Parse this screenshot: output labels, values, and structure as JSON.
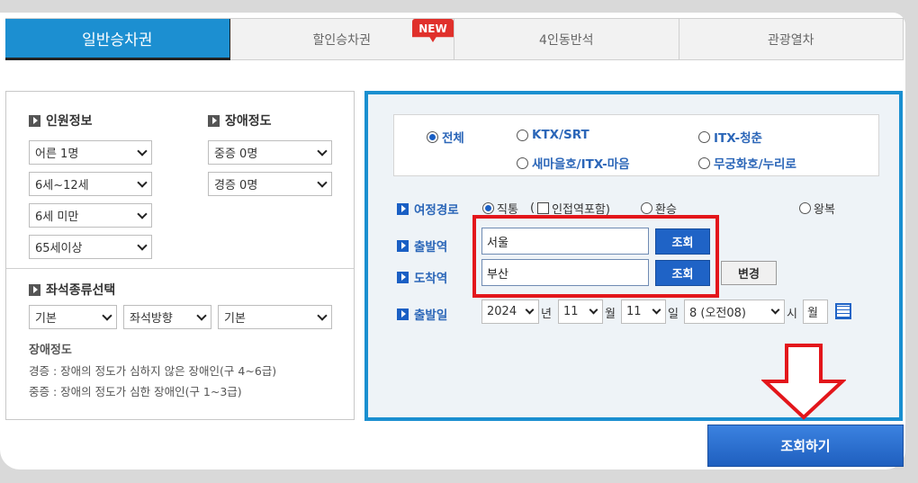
{
  "tabs": [
    {
      "label": "일반승차권",
      "active": true
    },
    {
      "label": "할인승차권",
      "active": false
    },
    {
      "label": "4인동반석",
      "active": false
    },
    {
      "label": "관광열차",
      "active": false
    }
  ],
  "new_badge": "NEW",
  "passengers": {
    "title": "인원정보",
    "adult": "어른 1명",
    "child": "6세~12세",
    "infant": "6세 미만",
    "senior": "65세이상"
  },
  "disability": {
    "title": "장애정도",
    "severe": "중증 0명",
    "mild": "경증 0명"
  },
  "seat": {
    "title": "좌석종류선택",
    "type": "기본",
    "direction": "좌석방향",
    "option": "기본"
  },
  "notes": {
    "title": "장애정도",
    "line1": "경증 : 장애의 정도가 심하지 않은 장애인(구 4~6급)",
    "line2": "중증 : 장애의 정도가 심한 장애인(구 1~3급)"
  },
  "train_types": {
    "all": "전체",
    "ktx": "KTX/SRT",
    "itx_cheongchun": "ITX-청춘",
    "saemaeul": "새마을호/ITX-마음",
    "mugunghwa": "무궁화호/누리로"
  },
  "route": {
    "label": "여정경로",
    "direct": "직통",
    "nearby_open": "(",
    "nearby": "인접역포함)",
    "transfer": "환승",
    "round": "왕복"
  },
  "departure": {
    "label": "출발역",
    "value": "서울",
    "button": "조회"
  },
  "arrival": {
    "label": "도착역",
    "value": "부산",
    "button": "조회",
    "swap": "변경"
  },
  "date": {
    "label": "출발일",
    "year": "2024",
    "year_unit": "년",
    "month": "11",
    "month_unit": "월",
    "day": "11",
    "day_unit": "일",
    "hour": "8 (오전08)",
    "hour_unit": "시",
    "weekday": "월"
  },
  "search_button": "조회하기",
  "colors": {
    "accent": "#1a8fd0",
    "highlight": "#e3161b",
    "button": "#1f63c6"
  }
}
